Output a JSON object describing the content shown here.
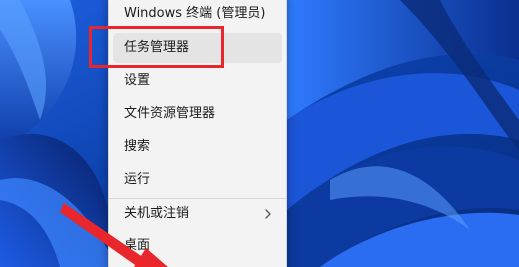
{
  "menu": {
    "items": [
      {
        "label": "Windows 终端 (管理员)"
      },
      {
        "label": "任务管理器"
      },
      {
        "label": "设置"
      },
      {
        "label": "文件资源管理器"
      },
      {
        "label": "搜索"
      },
      {
        "label": "运行"
      },
      {
        "label": "关机或注销"
      },
      {
        "label": "桌面"
      }
    ],
    "submenu_icon": "chevron-right-icon"
  },
  "annotation": {
    "highlight_color": "#e8262b",
    "arrow_color": "#e8262b",
    "highlighted_item": "任务管理器"
  },
  "colors": {
    "menu_background": "#f3f3f3",
    "hover_background": "#e4e4e4",
    "wallpaper_blue": "#0b3fa8"
  }
}
